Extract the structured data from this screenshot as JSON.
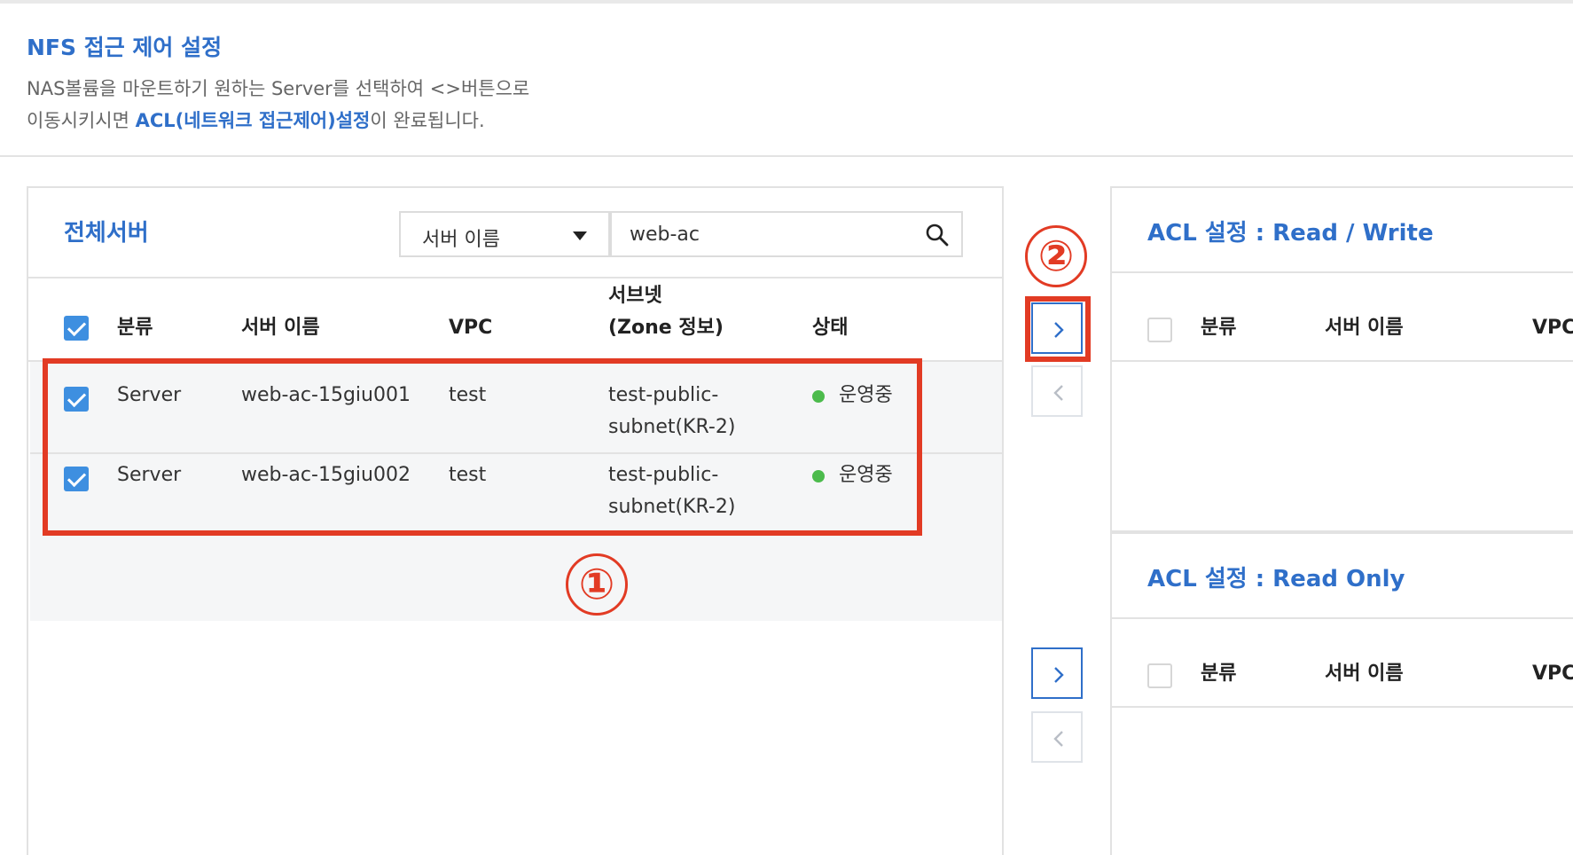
{
  "header": {
    "title": "NFS 접근 제어 설정",
    "desc_line1": "NAS볼륨을 마운트하기 원하는 Server를 선택하여 <>버튼으로",
    "desc_line2_prefix": "이동시키시면 ",
    "desc_line2_highlight": "ACL(네트워크 접근제어)설정",
    "desc_line2_suffix": "이 완료됩니다."
  },
  "left_panel": {
    "title": "전체서버",
    "search_select": "서버 이름",
    "search_value": "web-ac",
    "columns": {
      "type": "분류",
      "name": "서버 이름",
      "vpc": "VPC",
      "subnet_line1": "서브넷",
      "subnet_line2": "(Zone 정보)",
      "status": "상태"
    },
    "rows": [
      {
        "checked": true,
        "type": "Server",
        "name": "web-ac-15giu001",
        "vpc": "test",
        "subnet_line1": "test-public-",
        "subnet_line2": "subnet(KR-2)",
        "status": "운영중"
      },
      {
        "checked": true,
        "type": "Server",
        "name": "web-ac-15giu002",
        "vpc": "test",
        "subnet_line1": "test-public-",
        "subnet_line2": "subnet(KR-2)",
        "status": "운영중"
      }
    ]
  },
  "acl_rw": {
    "title": "ACL 설정 : Read / Write",
    "columns": {
      "type": "분류",
      "name": "서버 이름",
      "vpc": "VPC"
    }
  },
  "acl_ro": {
    "title": "ACL 설정 : Read Only",
    "columns": {
      "type": "분류",
      "name": "서버 이름",
      "vpc": "VPC"
    }
  },
  "annotations": {
    "step1": "①",
    "step2": "②"
  },
  "icons": {
    "search": "search-icon",
    "dropdown": "caret-down-icon",
    "move_right": "chevron-right-icon",
    "move_left": "chevron-left-icon"
  },
  "colors": {
    "accent": "#2f6fc9",
    "highlight": "#e23b24",
    "checkbox": "#3e8fe0",
    "status_running": "#4cbb4c"
  }
}
